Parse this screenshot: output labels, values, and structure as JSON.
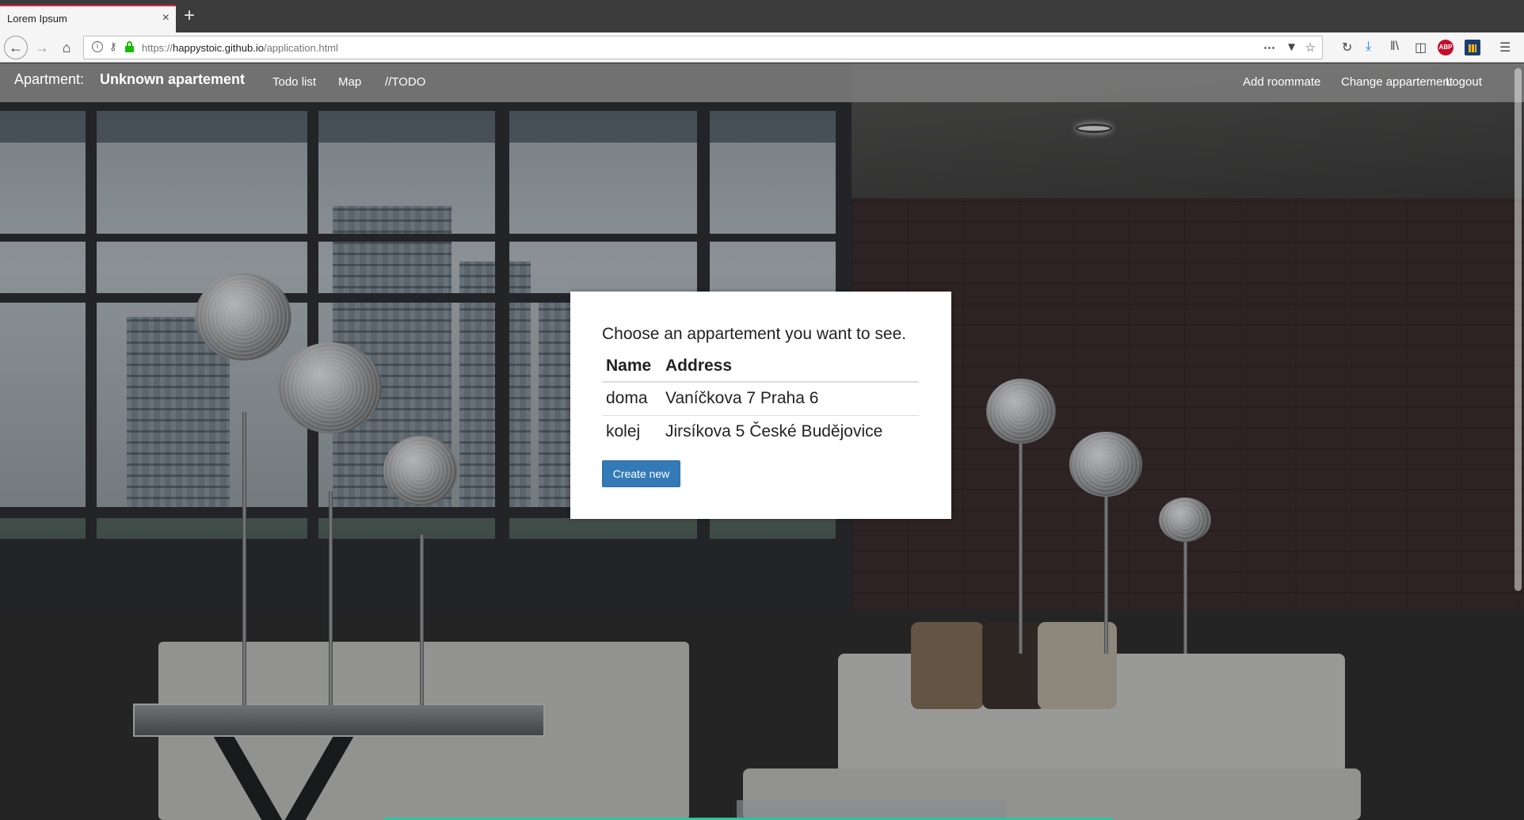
{
  "browser": {
    "tab_title": "Lorem Ipsum",
    "tab_close": "×",
    "new_tab": "+",
    "url_scheme": "https://",
    "url_host": "happystoic.github.io",
    "url_path": "/application.html",
    "icons": [
      "back-icon",
      "forward-icon",
      "home-icon",
      "info-icon",
      "key-icon",
      "lock-icon",
      "more-icon",
      "pocket-icon",
      "bookmark-star-icon",
      "reload-icon",
      "download-icon",
      "library-icon",
      "sidebar-icon",
      "adblock-icon",
      "extension-icon",
      "menu-icon"
    ]
  },
  "app_nav": {
    "brand_label": "Apartment:",
    "brand_name": "Unknown apartement",
    "left_links": [
      "Todo list",
      "Map",
      "//TODO"
    ],
    "right_links": [
      "Add roommate",
      "Change appartement",
      "Logout"
    ]
  },
  "modal": {
    "title": "Choose an appartement you want to see.",
    "headers": {
      "name": "Name",
      "address": "Address"
    },
    "rows": [
      {
        "name": "doma",
        "address": "Vaníčkova 7 Praha 6"
      },
      {
        "name": "kolej",
        "address": "Jirsíkova 5 České Budějovice"
      }
    ],
    "create_button": "Create new"
  },
  "colors": {
    "primary_button": "#337ab7",
    "navbar": "#787878",
    "tab_accent": "#d7263d"
  }
}
